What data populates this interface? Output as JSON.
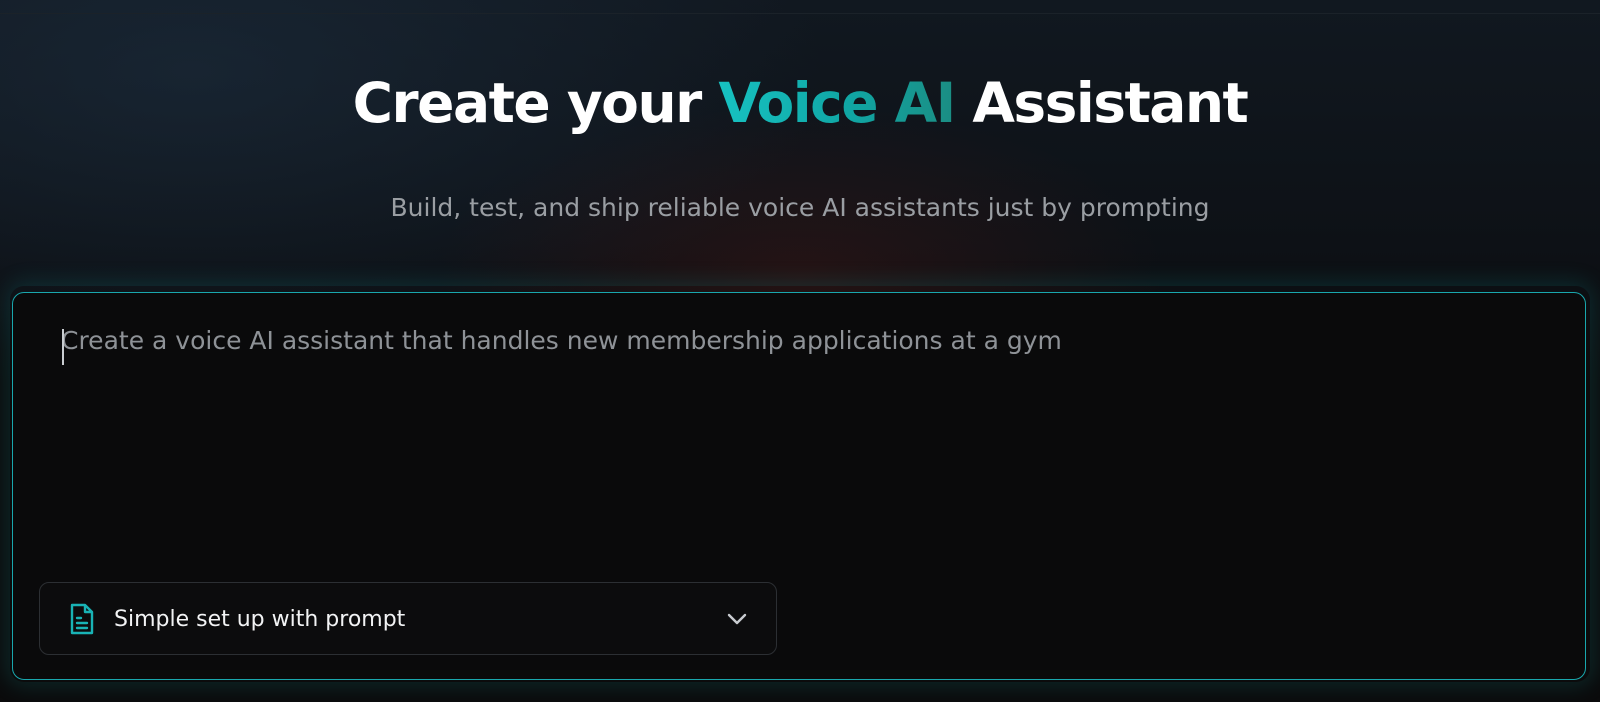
{
  "hero": {
    "title_part1": "Create your ",
    "title_accent": "Voice AI",
    "title_part2": " Assistant",
    "subtitle": "Build, test, and ship reliable voice AI assistants just by prompting"
  },
  "prompt": {
    "placeholder": "Create a voice AI assistant that handles new membership applications at a gym",
    "value": ""
  },
  "mode_select": {
    "selected": "Simple set up with prompt",
    "icon": "document-icon",
    "chevron": "chevron-down-icon"
  },
  "colors": {
    "accent": "#17c2c2",
    "accent_border": "#19a7ad",
    "background": "#0b0b0c",
    "title": "#ffffff",
    "subtitle": "#9a9ea3"
  }
}
